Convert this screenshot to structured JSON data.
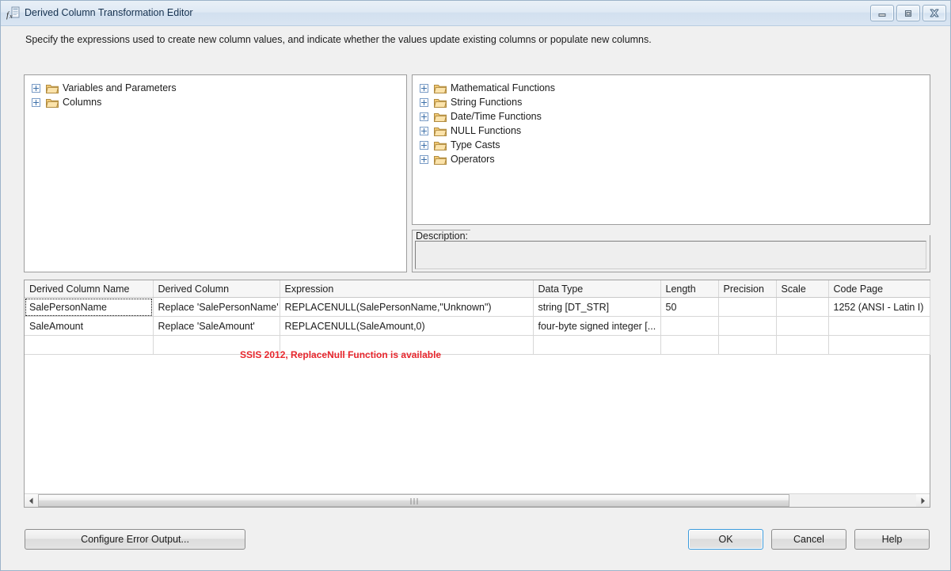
{
  "window": {
    "title": "Derived Column Transformation Editor",
    "icon": "function-editor-icon",
    "controls": {
      "minimize": "Minimize",
      "maximize": "Maximize",
      "close": "Close"
    }
  },
  "instruction": "Specify the expressions used to create new column values, and indicate whether the values update existing columns or populate new columns.",
  "left_tree": {
    "items": [
      {
        "label": "Variables and Parameters",
        "icon": "folder-icon",
        "expander": "plus-icon"
      },
      {
        "label": "Columns",
        "icon": "folder-icon",
        "expander": "plus-icon"
      }
    ]
  },
  "right_tree": {
    "items": [
      {
        "label": "Mathematical Functions",
        "icon": "folder-icon",
        "expander": "plus-icon"
      },
      {
        "label": "String Functions",
        "icon": "folder-icon",
        "expander": "plus-icon"
      },
      {
        "label": "Date/Time Functions",
        "icon": "folder-icon",
        "expander": "plus-icon"
      },
      {
        "label": "NULL Functions",
        "icon": "folder-icon",
        "expander": "plus-icon"
      },
      {
        "label": "Type Casts",
        "icon": "folder-icon",
        "expander": "plus-icon"
      },
      {
        "label": "Operators",
        "icon": "folder-icon",
        "expander": "plus-icon"
      }
    ]
  },
  "description": {
    "legend": "Description:",
    "value": ""
  },
  "grid": {
    "columns": [
      "Derived Column Name",
      "Derived Column",
      "Expression",
      "Data Type",
      "Length",
      "Precision",
      "Scale",
      "Code Page"
    ],
    "rows": [
      {
        "derived_column_name": "SalePersonName",
        "derived_column": "Replace 'SalePersonName'",
        "expression": "REPLACENULL(SalePersonName,\"Unknown\")",
        "data_type": "string [DT_STR]",
        "length": "50",
        "precision": "",
        "scale": "",
        "code_page": "1252  (ANSI - Latin I)"
      },
      {
        "derived_column_name": "SaleAmount",
        "derived_column": "Replace 'SaleAmount'",
        "expression": "REPLACENULL(SaleAmount,0)",
        "data_type": "four-byte signed integer [...",
        "length": "",
        "precision": "",
        "scale": "",
        "code_page": ""
      },
      {
        "derived_column_name": "",
        "derived_column": "",
        "expression": "",
        "data_type": "",
        "length": "",
        "precision": "",
        "scale": "",
        "code_page": ""
      }
    ]
  },
  "annotation": {
    "text": "SSIS 2012, ReplaceNull Function is available",
    "color": "#e8262d"
  },
  "scrollbar": {
    "left_arrow": "scroll-left-icon",
    "right_arrow": "scroll-right-icon",
    "grip": "grip-icon"
  },
  "footer": {
    "configure_error_output": "Configure Error Output...",
    "ok": "OK",
    "cancel": "Cancel",
    "help": "Help"
  },
  "colors": {
    "focus_border": "#3c9bdc",
    "annotation": "#e8262d",
    "title_text": "#15314f"
  }
}
